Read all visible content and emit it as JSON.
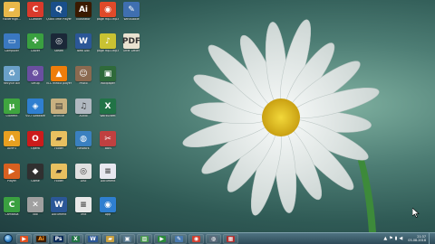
{
  "desktop_icons": [
    {
      "name": "folder-icon",
      "label": "FolderHigh...",
      "color": "#e8b84a",
      "glyph": "▰",
      "col": 0,
      "row": 0
    },
    {
      "name": "ccleaner-icon",
      "label": "CCleaner",
      "color": "#d93a2b",
      "glyph": "C",
      "col": 1,
      "row": 0
    },
    {
      "name": "quicktime-icon",
      "label": "QuickTime Player",
      "color": "#1a4f8a",
      "glyph": "Q",
      "col": 2,
      "row": 0
    },
    {
      "name": "illustrator-icon",
      "label": "Illustrator",
      "color": "#3a1a00",
      "glyph": "Ai",
      "col": 3,
      "row": 0
    },
    {
      "name": "media-file-icon",
      "label": "page mp3.mp3",
      "color": "#e04a2a",
      "glyph": "◉",
      "col": 4,
      "row": 0
    },
    {
      "name": "notepad-icon",
      "label": "WinBubble",
      "color": "#3f6fb0",
      "glyph": "✎",
      "col": 5,
      "row": 0
    },
    {
      "name": "computer-icon",
      "label": "Computer",
      "color": "#3a78c0",
      "glyph": "▭",
      "col": 0,
      "row": 1
    },
    {
      "name": "clover-icon",
      "label": "Clover",
      "color": "#3aa040",
      "glyph": "✤",
      "col": 1,
      "row": 1
    },
    {
      "name": "steam-icon",
      "label": "Steam",
      "color": "#1b2838",
      "glyph": "◎",
      "col": 2,
      "row": 1
    },
    {
      "name": "word-doc-icon",
      "label": "New Doc",
      "color": "#2b5797",
      "glyph": "W",
      "col": 3,
      "row": 1
    },
    {
      "name": "audio-file-icon",
      "label": "page mp3.mp3",
      "color": "#c9c232",
      "glyph": "♪",
      "col": 4,
      "row": 1
    },
    {
      "name": "pdf-file-icon",
      "label": "Offer Letter",
      "color": "#e9e2d0",
      "glyph": "PDF",
      "col": 5,
      "row": 1
    },
    {
      "name": "recycle-bin-icon",
      "label": "Recycle Bin",
      "color": "#6aa0c8",
      "glyph": "♻",
      "col": 0,
      "row": 2
    },
    {
      "name": "setup-icon",
      "label": "Setup",
      "color": "#6a4fa0",
      "glyph": "⚙",
      "col": 1,
      "row": 2
    },
    {
      "name": "vlc-icon",
      "label": "VLC media player",
      "color": "#ee7d0a",
      "glyph": "▲",
      "col": 2,
      "row": 2
    },
    {
      "name": "person-photo-icon",
      "label": "Photo",
      "color": "#8b6a50",
      "glyph": "☺",
      "col": 3,
      "row": 2
    },
    {
      "name": "image-file-icon",
      "label": "Wallpaper",
      "color": "#2f6a3a",
      "glyph": "▣",
      "col": 4,
      "row": 2
    },
    {
      "name": "utorrent-icon",
      "label": "uTorrent",
      "color": "#3fa53f",
      "glyph": "µ",
      "col": 0,
      "row": 3
    },
    {
      "name": "shortcut-icon",
      "label": "VSO Software",
      "color": "#2f7fd0",
      "glyph": "◈",
      "col": 1,
      "row": 3
    },
    {
      "name": "archive-icon",
      "label": "Archive",
      "color": "#c8b080",
      "glyph": "▤",
      "col": 2,
      "row": 3
    },
    {
      "name": "audio-tool-icon",
      "label": "Audio",
      "color": "#b0b8c0",
      "glyph": "♫",
      "col": 3,
      "row": 3
    },
    {
      "name": "excel-doc-icon",
      "label": "WorkSheet",
      "color": "#217346",
      "glyph": "X",
      "col": 4,
      "row": 3
    },
    {
      "name": "aimp-icon",
      "label": "AIMP3",
      "color": "#e8a020",
      "glyph": "A",
      "col": 0,
      "row": 4
    },
    {
      "name": "opera-icon",
      "label": "Opera",
      "color": "#cc1b1b",
      "glyph": "O",
      "col": 1,
      "row": 4
    },
    {
      "name": "folder-icon",
      "label": "Folder",
      "color": "#e8c060",
      "glyph": "▰",
      "col": 2,
      "row": 4
    },
    {
      "name": "network-icon",
      "label": "Network",
      "color": "#3a80c0",
      "glyph": "◍",
      "col": 3,
      "row": 4
    },
    {
      "name": "tools-icon",
      "label": "Tools",
      "color": "#c04040",
      "glyph": "✂",
      "col": 4,
      "row": 4
    },
    {
      "name": "media-player-icon",
      "label": "Player",
      "color": "#d86020",
      "glyph": "▶",
      "col": 0,
      "row": 5
    },
    {
      "name": "game-icon",
      "label": "Game",
      "color": "#303030",
      "glyph": "◆",
      "col": 1,
      "row": 5
    },
    {
      "name": "folder-icon",
      "label": "Folder",
      "color": "#e8c060",
      "glyph": "▰",
      "col": 2,
      "row": 5
    },
    {
      "name": "disc-icon",
      "label": "Disc",
      "color": "#e0e0e0",
      "glyph": "◎",
      "col": 3,
      "row": 5
    },
    {
      "name": "document-icon",
      "label": "Document",
      "color": "#e8e8f0",
      "glyph": "≡",
      "col": 4,
      "row": 5
    },
    {
      "name": "camtasia-icon",
      "label": "Camtasia",
      "color": "#3aa040",
      "glyph": "C",
      "col": 0,
      "row": 6
    },
    {
      "name": "cross-tool-icon",
      "label": "Tool",
      "color": "#a0a0a0",
      "glyph": "✕",
      "col": 1,
      "row": 6
    },
    {
      "name": "word-doc-icon",
      "label": "Document",
      "color": "#2b5797",
      "glyph": "W",
      "col": 2,
      "row": 6
    },
    {
      "name": "text-file-icon",
      "label": "Text",
      "color": "#e8e8e8",
      "glyph": "≡",
      "col": 3,
      "row": 6
    },
    {
      "name": "app-icon",
      "label": "App",
      "color": "#2f7fd0",
      "glyph": "◉",
      "col": 4,
      "row": 6
    }
  ],
  "taskbar": {
    "items": [
      {
        "name": "taskbar-media-icon",
        "glyph": "▶",
        "color": "#e05020"
      },
      {
        "name": "taskbar-illustrator-icon",
        "glyph": "Ai",
        "color": "#3a1a00"
      },
      {
        "name": "taskbar-photoshop-icon",
        "glyph": "Ps",
        "color": "#0a2a5a"
      },
      {
        "name": "taskbar-excel-icon",
        "glyph": "X",
        "color": "#217346"
      },
      {
        "name": "taskbar-word-icon",
        "glyph": "W",
        "color": "#2b5797"
      },
      {
        "name": "taskbar-explorer-icon",
        "glyph": "▰",
        "color": "#c8a040"
      },
      {
        "name": "taskbar-app-icon",
        "glyph": "▣",
        "color": "#5a7a90"
      },
      {
        "name": "taskbar-photos-icon",
        "glyph": "▨",
        "color": "#4a9a50"
      },
      {
        "name": "taskbar-player-icon",
        "glyph": "▶",
        "color": "#2a8a3a"
      },
      {
        "name": "taskbar-paint-icon",
        "glyph": "✎",
        "color": "#4a7ab0"
      },
      {
        "name": "taskbar-browser-icon",
        "glyph": "◉",
        "color": "#d04030"
      },
      {
        "name": "taskbar-settings-icon",
        "glyph": "◍",
        "color": "#5a6a7a"
      },
      {
        "name": "taskbar-image-icon",
        "glyph": "▦",
        "color": "#b03030"
      }
    ],
    "time": "21:37",
    "date": "05-08-2018"
  }
}
